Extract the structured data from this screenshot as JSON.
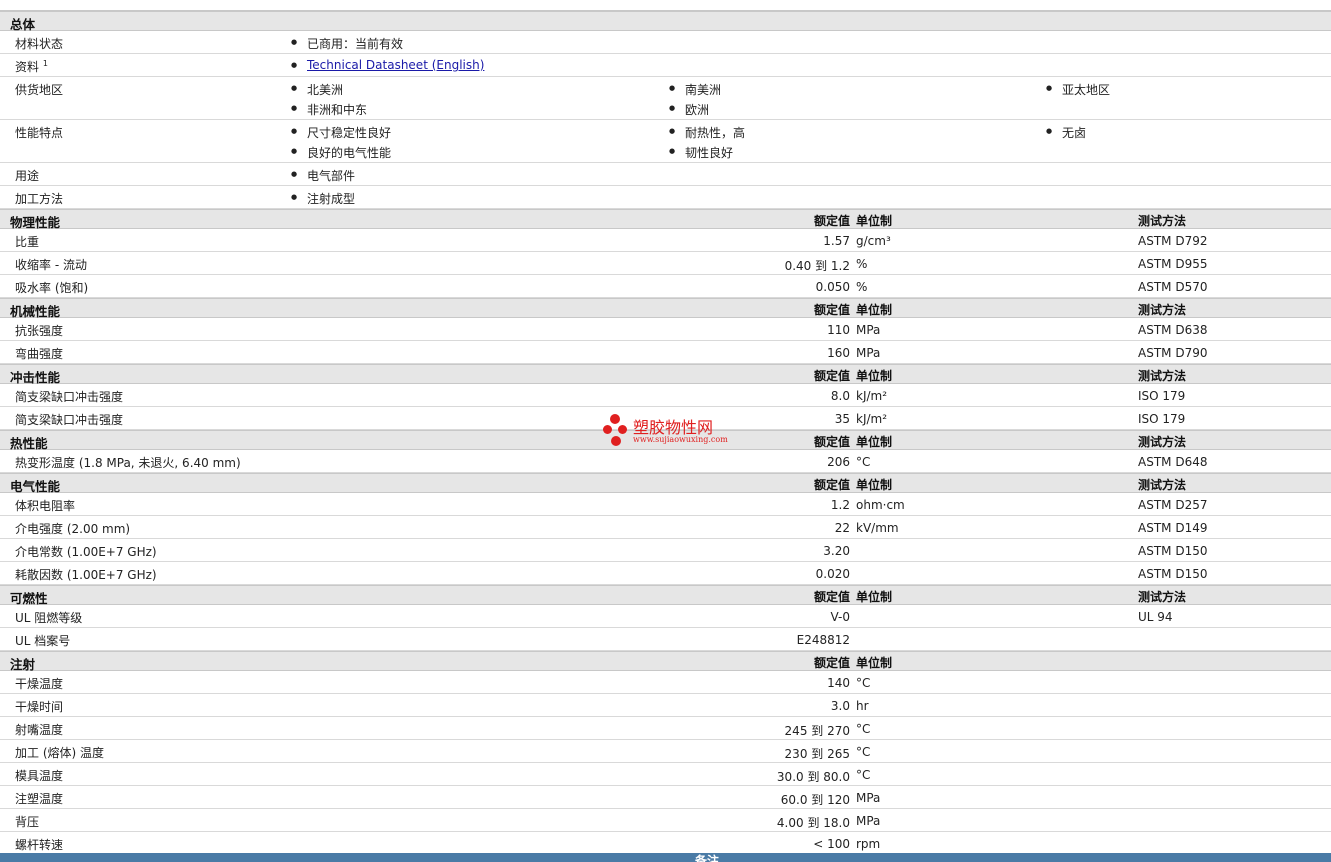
{
  "headers": {
    "value": "额定值",
    "unit": "单位制",
    "test": "测试方法"
  },
  "general": {
    "title": "总体",
    "material_status": {
      "label": "材料状态",
      "value": "已商用：当前有效"
    },
    "source": {
      "label": "资料",
      "sup": "1",
      "link": "Technical Datasheet (English)"
    },
    "supply": {
      "label": "供货地区",
      "items": [
        "北美洲",
        "南美洲",
        "亚太地区",
        "非洲和中东",
        "欧洲"
      ]
    },
    "features": {
      "label": "性能特点",
      "items": [
        "尺寸稳定性良好",
        "耐热性，高",
        "无卤",
        "良好的电气性能",
        "韧性良好"
      ]
    },
    "uses": {
      "label": "用途",
      "value": "电气部件"
    },
    "processing": {
      "label": "加工方法",
      "value": "注射成型"
    }
  },
  "physical": {
    "title": "物理性能",
    "rows": [
      {
        "label": "比重",
        "value": "1.57",
        "unit": "g/cm³",
        "test": "ASTM D792"
      },
      {
        "label": "收缩率 - 流动",
        "value": "0.40 到  1.2",
        "unit": "%",
        "test": "ASTM D955"
      },
      {
        "label": "吸水率 (饱和)",
        "value": "0.050",
        "unit": "%",
        "test": "ASTM D570"
      }
    ]
  },
  "mechanical": {
    "title": "机械性能",
    "rows": [
      {
        "label": "抗张强度",
        "value": "110",
        "unit": "MPa",
        "test": "ASTM D638"
      },
      {
        "label": "弯曲强度",
        "value": "160",
        "unit": "MPa",
        "test": "ASTM D790"
      }
    ]
  },
  "impact": {
    "title": "冲击性能",
    "rows": [
      {
        "label": "简支梁缺口冲击强度",
        "value": "8.0",
        "unit": "kJ/m²",
        "test": "ISO 179"
      },
      {
        "label": "简支梁缺口冲击强度",
        "value": "35",
        "unit": "kJ/m²",
        "test": "ISO 179"
      }
    ]
  },
  "thermal": {
    "title": "热性能",
    "rows": [
      {
        "label": "热变形温度 (1.8 MPa, 未退火, 6.40 mm)",
        "value": "206",
        "unit": "°C",
        "test": "ASTM D648"
      }
    ]
  },
  "electrical": {
    "title": "电气性能",
    "rows": [
      {
        "label": "体积电阻率",
        "value": "1.2",
        "unit": "ohm·cm",
        "test": "ASTM D257"
      },
      {
        "label": "介电强度 (2.00 mm)",
        "value": "22",
        "unit": "kV/mm",
        "test": "ASTM D149"
      },
      {
        "label": "介电常数 (1.00E+7 GHz)",
        "value": "3.20",
        "unit": "",
        "test": "ASTM D150"
      },
      {
        "label": "耗散因数 (1.00E+7 GHz)",
        "value": "0.020",
        "unit": "",
        "test": "ASTM D150"
      }
    ]
  },
  "flammability": {
    "title": "可燃性",
    "rows": [
      {
        "label": "UL 阻燃等级",
        "value": "V-0",
        "unit": "",
        "test": "UL 94"
      },
      {
        "label": "UL 档案号",
        "value": "E248812",
        "unit": "",
        "test": ""
      }
    ]
  },
  "injection": {
    "title": "注射",
    "rows": [
      {
        "label": "干燥温度",
        "value": "140",
        "unit": "°C"
      },
      {
        "label": "干燥时间",
        "value": "3.0",
        "unit": "hr"
      },
      {
        "label": "射嘴温度",
        "value": "245 到  270",
        "unit": "°C"
      },
      {
        "label": "加工 (熔体) 温度",
        "value": "230 到  265",
        "unit": "°C"
      },
      {
        "label": "模具温度",
        "value": "30.0 到  80.0",
        "unit": "°C"
      },
      {
        "label": "注塑温度",
        "value": "60.0 到  120",
        "unit": "MPa"
      },
      {
        "label": "背压",
        "value": "4.00 到  18.0",
        "unit": "MPa"
      },
      {
        "label": "螺杆转速",
        "value": "< 100",
        "unit": "rpm"
      }
    ]
  },
  "watermark": {
    "name": "塑胶物性网",
    "url": "www.sujiaowuxing.com"
  },
  "footer": {
    "title": "备注"
  },
  "colors": {
    "section_bg": "#e6e6e6",
    "footer_bg": "#4a7ba6",
    "watermark": "#e02020",
    "link": "#1a1aa8"
  }
}
